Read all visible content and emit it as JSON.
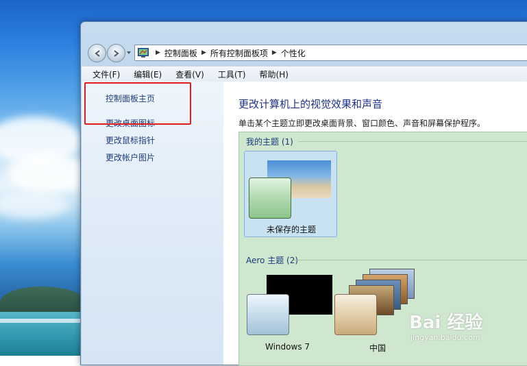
{
  "window": {
    "breadcrumb": [
      "控制面板",
      "所有控制面板项",
      "个性化"
    ]
  },
  "menu": [
    "文件(F)",
    "编辑(E)",
    "查看(V)",
    "工具(T)",
    "帮助(H)"
  ],
  "sidebar": {
    "items": [
      {
        "label": "控制面板主页"
      },
      {
        "label": "更改桌面图标"
      },
      {
        "label": "更改鼠标指针"
      },
      {
        "label": "更改帐户图片"
      }
    ]
  },
  "main": {
    "title": "更改计算机上的视觉效果和声音",
    "subtitle": "单击某个主题立即更改桌面背景、窗口颜色、声音和屏幕保护程序。",
    "groups": [
      {
        "label": "我的主题 (1)",
        "themes": [
          {
            "label": "未保存的主题"
          }
        ]
      },
      {
        "label": "Aero 主题 (2)",
        "themes": [
          {
            "label": "Windows 7"
          },
          {
            "label": "中国"
          }
        ]
      }
    ]
  },
  "watermark": {
    "brand": "Bai 经验",
    "url": "jingyan.baidu.com"
  },
  "colors": {
    "highlight": "#e01c1c",
    "title": "#1e3287",
    "link": "#1e3c78",
    "theme_area": "#cfe6cf"
  }
}
